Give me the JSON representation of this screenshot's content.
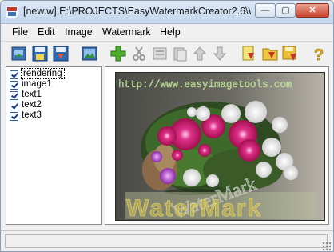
{
  "window": {
    "title": "[new.w] E:\\PROJECTS\\EasyWatermarkCreator2.6\\W...",
    "min_glyph": "—",
    "max_glyph": "▢",
    "close_glyph": "✕"
  },
  "menu": {
    "items": [
      {
        "label": "File"
      },
      {
        "label": "Edit"
      },
      {
        "label": "Image"
      },
      {
        "label": "Watermark"
      },
      {
        "label": "Help"
      }
    ]
  },
  "toolbar": {
    "buttons": [
      "open-icon",
      "save-icon",
      "save-as-icon",
      "image-icon",
      "add-icon",
      "cut-icon",
      "copy-icon",
      "paste-icon",
      "move-up-icon",
      "move-down-icon",
      "watermark-file-icon",
      "watermark-folder-icon",
      "watermark-save-icon",
      "help-icon"
    ]
  },
  "layers": {
    "items": [
      {
        "label": "rendering",
        "checked": true,
        "selected": true
      },
      {
        "label": "image1",
        "checked": true,
        "selected": false
      },
      {
        "label": "text1",
        "checked": true,
        "selected": false
      },
      {
        "label": "text2",
        "checked": true,
        "selected": false
      },
      {
        "label": "text3",
        "checked": true,
        "selected": false
      }
    ]
  },
  "preview": {
    "url_text": "http://www.easyimagetools.com",
    "diagonal_text": "WaterMark",
    "bottom_text": "WaterMark"
  }
}
